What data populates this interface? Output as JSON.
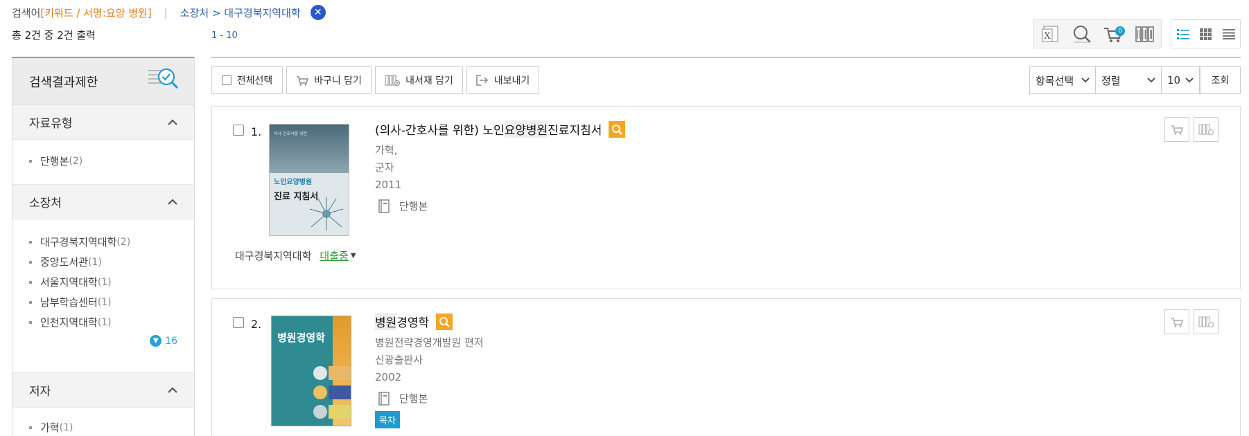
{
  "search": {
    "label": "검색어",
    "keyword": "[키워드 / 서명:요양 병원]",
    "separator": "|",
    "breadcrumb": "소장처 > 대구경북지역대학",
    "clear": "✕"
  },
  "summary": {
    "total_text": "총 2건 중 2건 출력",
    "range": "1 - 10"
  },
  "cart_count": "0",
  "sidebar": {
    "title": "검색결과제한",
    "facets": [
      {
        "title": "자료유형",
        "items": [
          {
            "label": "단행본",
            "count": "(2)"
          }
        ]
      },
      {
        "title": "소장처",
        "items": [
          {
            "label": "대구경북지역대학",
            "count": "(2)"
          },
          {
            "label": "중앙도서관",
            "count": "(1)"
          },
          {
            "label": "서울지역대학",
            "count": "(1)"
          },
          {
            "label": "남부학습센터",
            "count": "(1)"
          },
          {
            "label": "인천지역대학",
            "count": "(1)"
          }
        ],
        "more": "16"
      },
      {
        "title": "저자",
        "items": [
          {
            "label": "가혁",
            "count": "(1)"
          }
        ]
      }
    ]
  },
  "actions": {
    "select_all": "전체선택",
    "cart": "바구니 담기",
    "shelf": "내서재 담기",
    "export": "내보내기",
    "field_select": "항목선택",
    "sort": "정렬",
    "per_page": "10",
    "search_btn": "조회"
  },
  "results": [
    {
      "num": "1.",
      "title_pre": "(의사-간호사를 위한) 노인",
      "title_hl": "요양병원",
      "title_post": " 진료지침서",
      "author": "가혁,",
      "publisher": "군자",
      "year": "2011",
      "format": "단행본",
      "holding_lib": "대구경북지역대학",
      "holding_status": "대출중",
      "cover_text_top": "의사 간호사를 위한",
      "cover_text_1": "노인요양병원",
      "cover_text_2": "진료 지침서"
    },
    {
      "num": "2.",
      "title_hl": "병원",
      "title_post": "경영학",
      "author": "병원전략경영개발원 편저",
      "publisher": "신광출판사",
      "year": "2002",
      "format": "단행본",
      "toc": "목차",
      "cover_text_1": "병원경영학"
    }
  ]
}
